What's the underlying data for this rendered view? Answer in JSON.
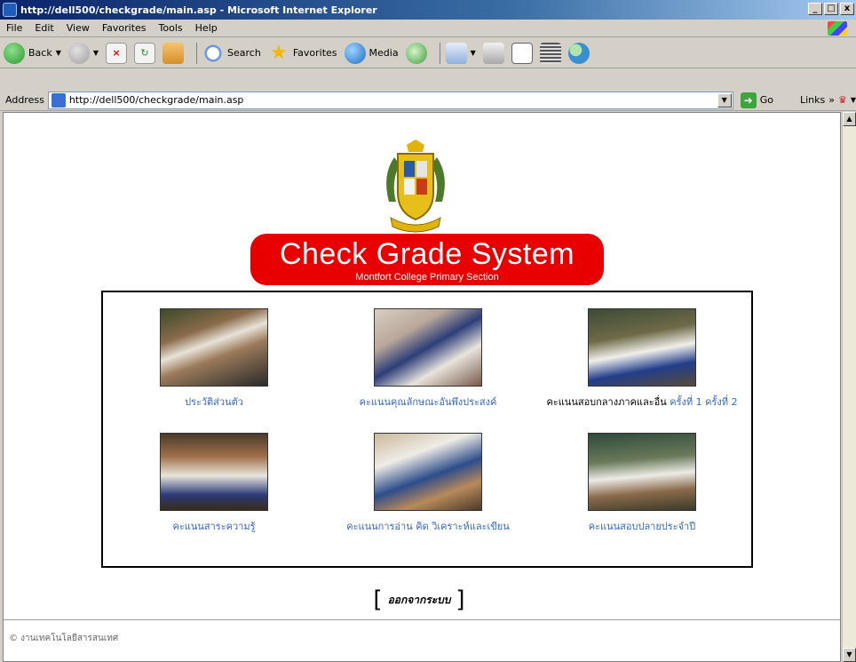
{
  "window": {
    "title": "http://dell500/checkgrade/main.asp - Microsoft Internet Explorer",
    "controls": [
      "_",
      "□",
      "x"
    ]
  },
  "menu": [
    "File",
    "Edit",
    "View",
    "Favorites",
    "Tools",
    "Help"
  ],
  "toolbar": {
    "back_label": "Back",
    "search_label": "Search",
    "favorites_label": "Favorites",
    "media_label": "Media"
  },
  "address": {
    "label": "Address",
    "url": "http://dell500/checkgrade/main.asp",
    "go_label": "Go",
    "links_label": "Links"
  },
  "page": {
    "banner_title": "Check Grade System",
    "banner_subtitle": "Montfort College Primary Section",
    "menu_items": [
      {
        "label": "ประวัติส่วนตัว"
      },
      {
        "label": "คะแนนคุณลักษณะอันพึงประสงค์"
      },
      {
        "label": "คะแนนสอบกลางภาคและอื่น",
        "link1": "ครั้งที่ 1",
        "link2": "ครั้งที่ 2"
      },
      {
        "label": "คะแนนสาระความรู้"
      },
      {
        "label": "คะแนนการอ่าน คิด วิเคราะห์และเขียน"
      },
      {
        "label": "คะแนนสอบปลายประจำปี"
      }
    ],
    "logout_label": "ออกจากระบบ",
    "footer": "© งานเทคโนโลยีสารสนเทศ"
  },
  "colors": {
    "banner_red": "#e80000",
    "link_blue": "#3366cc",
    "title_blue": "#0a246a"
  },
  "icons": [
    "ie-icon",
    "back-icon",
    "forward-icon",
    "stop-icon",
    "refresh-icon",
    "home-icon",
    "search-icon",
    "favorites-icon",
    "media-icon",
    "history-icon",
    "mail-icon",
    "print-icon",
    "edit-icon",
    "discuss-icon",
    "messenger-icon",
    "go-icon",
    "crest-icon"
  ]
}
